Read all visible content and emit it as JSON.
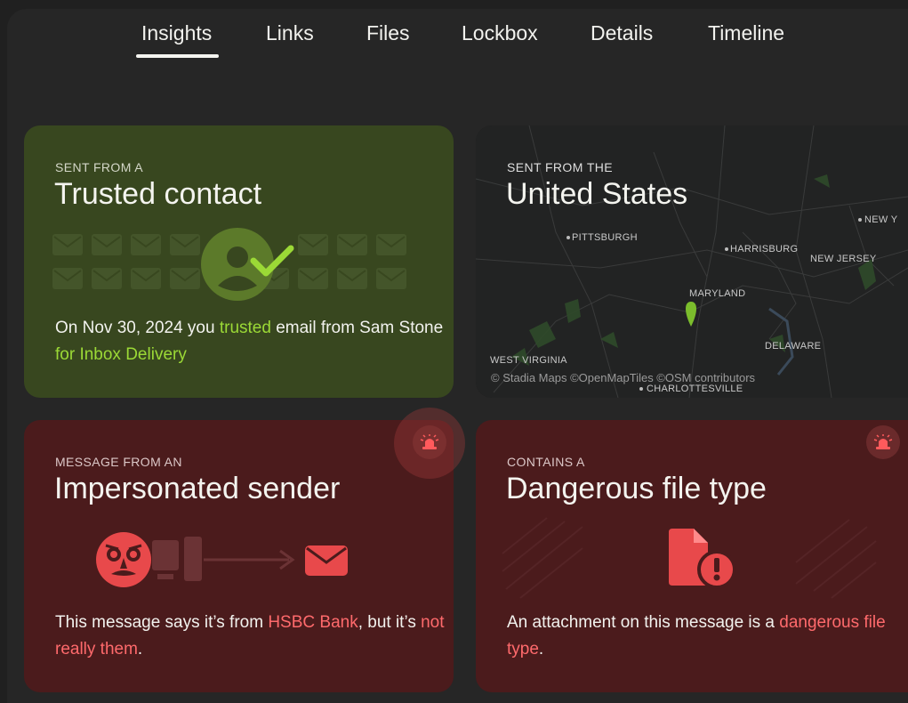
{
  "tabs": [
    {
      "label": "Insights",
      "active": true
    },
    {
      "label": "Links"
    },
    {
      "label": "Files"
    },
    {
      "label": "Lockbox"
    },
    {
      "label": "Details"
    },
    {
      "label": "Timeline"
    }
  ],
  "trusted": {
    "eyebrow": "SENT FROM A",
    "headline": "Trusted contact",
    "text_1": "On Nov 30, 2024 you ",
    "text_hl_1": "trusted",
    "text_2": " email from Sam Stone ",
    "text_hl_2": "for Inbox Delivery"
  },
  "location": {
    "eyebrow": "SENT FROM THE",
    "headline": "United States",
    "places": [
      "PITTSBURGH",
      "HARRISBURG",
      "NEW Y",
      "NEW JERSEY",
      "MARYLAND",
      "DELAWARE",
      "WEST VIRGINIA",
      "CHARLOTTESVILLE"
    ],
    "attribution": "© Stadia Maps ©OpenMapTiles ©OSM contributors"
  },
  "impersonated": {
    "eyebrow": "MESSAGE FROM AN",
    "headline": "Impersonated sender",
    "text_1": "This message says it’s from ",
    "text_hl_1": "HSBC Bank",
    "text_2": ", but it’s ",
    "text_hl_2": "not really them",
    "text_3": "."
  },
  "dangerous": {
    "eyebrow": "CONTAINS A",
    "headline": "Dangerous file type",
    "text_1": "An attachment on this message is a ",
    "text_hl_1": "dangerous file type",
    "text_2": "."
  },
  "colors": {
    "green_accent": "#9bd936",
    "red_accent": "#ff6a6c",
    "icon_red": "#e8494b"
  }
}
